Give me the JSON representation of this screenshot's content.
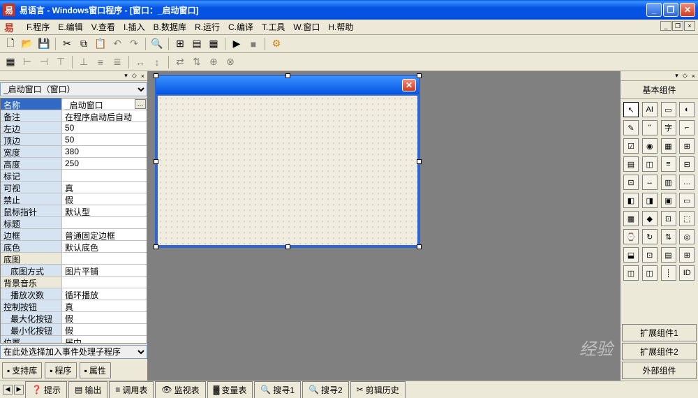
{
  "title": "易语言 - Windows窗口程序 - [窗口：_启动窗口]",
  "menus": [
    "F.程序",
    "E.编辑",
    "V.查看",
    "I.插入",
    "B.数据库",
    "R.运行",
    "C.编译",
    "T.工具",
    "W.窗口",
    "H.帮助"
  ],
  "propertyPanel": {
    "objectSelector": "_启动窗口（窗口）",
    "rows": [
      {
        "name": "名称",
        "value": "_启动窗口",
        "selected": true,
        "hasBtn": true
      },
      {
        "name": "备注",
        "value": "在程序启动后自动"
      },
      {
        "name": "左边",
        "value": "50"
      },
      {
        "name": "顶边",
        "value": "50"
      },
      {
        "name": "宽度",
        "value": "380"
      },
      {
        "name": "高度",
        "value": "250"
      },
      {
        "name": "标记",
        "value": ""
      },
      {
        "name": "可视",
        "value": "真"
      },
      {
        "name": "禁止",
        "value": "假"
      },
      {
        "name": "鼠标指针",
        "value": "默认型"
      },
      {
        "name": "标题",
        "value": ""
      },
      {
        "name": "边框",
        "value": "普通固定边框"
      },
      {
        "name": "底色",
        "value": "默认底色"
      },
      {
        "name": "底图",
        "value": "",
        "group": true
      },
      {
        "name": "底图方式",
        "value": "图片平铺",
        "sub": true
      },
      {
        "name": "背景音乐",
        "value": "",
        "group": true
      },
      {
        "name": "播放次数",
        "value": "循环播放",
        "sub": true
      },
      {
        "name": "控制按钮",
        "value": "真"
      },
      {
        "name": "最大化按钮",
        "value": "假",
        "sub": true
      },
      {
        "name": "最小化按钮",
        "value": "假",
        "sub": true
      },
      {
        "name": "位置",
        "value": "居中"
      }
    ],
    "eventPlaceholder": "在此处选择加入事件处理子程序",
    "bottomTabs": [
      "支持库",
      "程序",
      "属性"
    ]
  },
  "componentPanel": {
    "title": "基本组件",
    "components": [
      "↖",
      "AI",
      "▭",
      "◐",
      "✎",
      "\"",
      "字",
      "⌐",
      "☑",
      "◉",
      "▦",
      "⊞",
      "▤",
      "◫",
      "≡",
      "⊟",
      "⊡",
      "↔",
      "▥",
      "…",
      "◧",
      "◨",
      "▣",
      "▭",
      "▦",
      "◆",
      "⊡",
      "⬚",
      "⌚",
      "↻",
      "⇅",
      "◎",
      "⬓",
      "⊡",
      "▤",
      "⊞",
      "◫",
      "◫",
      "┊",
      "ID"
    ],
    "bottomButtons": [
      "扩展组件1",
      "扩展组件2",
      "外部组件"
    ]
  },
  "statusTabs": [
    "提示",
    "输出",
    "调用表",
    "监视表",
    "变量表",
    "搜寻1",
    "搜寻2",
    "剪辑历史"
  ],
  "watermark": "经验"
}
